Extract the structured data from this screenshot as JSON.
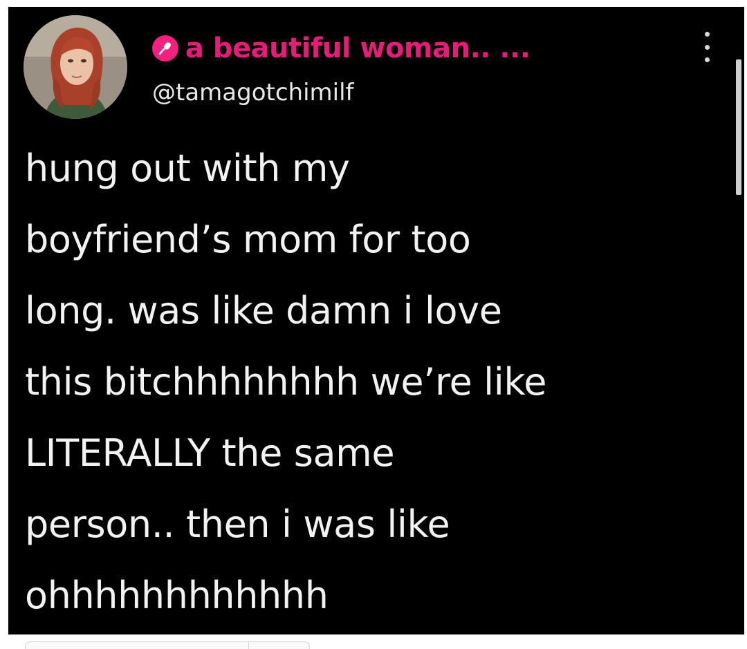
{
  "tweet": {
    "display_name": "a beautiful woman.. ...",
    "handle": "@tamagotchimilf",
    "text_lines": [
      "hung out with my",
      "boyfriend’s mom for too",
      "long. was like damn i love",
      "this bitchhhhhhhh we’re like",
      "LITERALLY the same",
      "person.. then i was like",
      "ohhhhhhhhhhhh"
    ]
  },
  "icons": {
    "display_name_badge": "microphone-icon",
    "menu": "more-vertical-icon"
  },
  "colors": {
    "background": "#000000",
    "display_name": "#e51c79",
    "badge": "#f0217f",
    "text": "#f2f2f2"
  }
}
